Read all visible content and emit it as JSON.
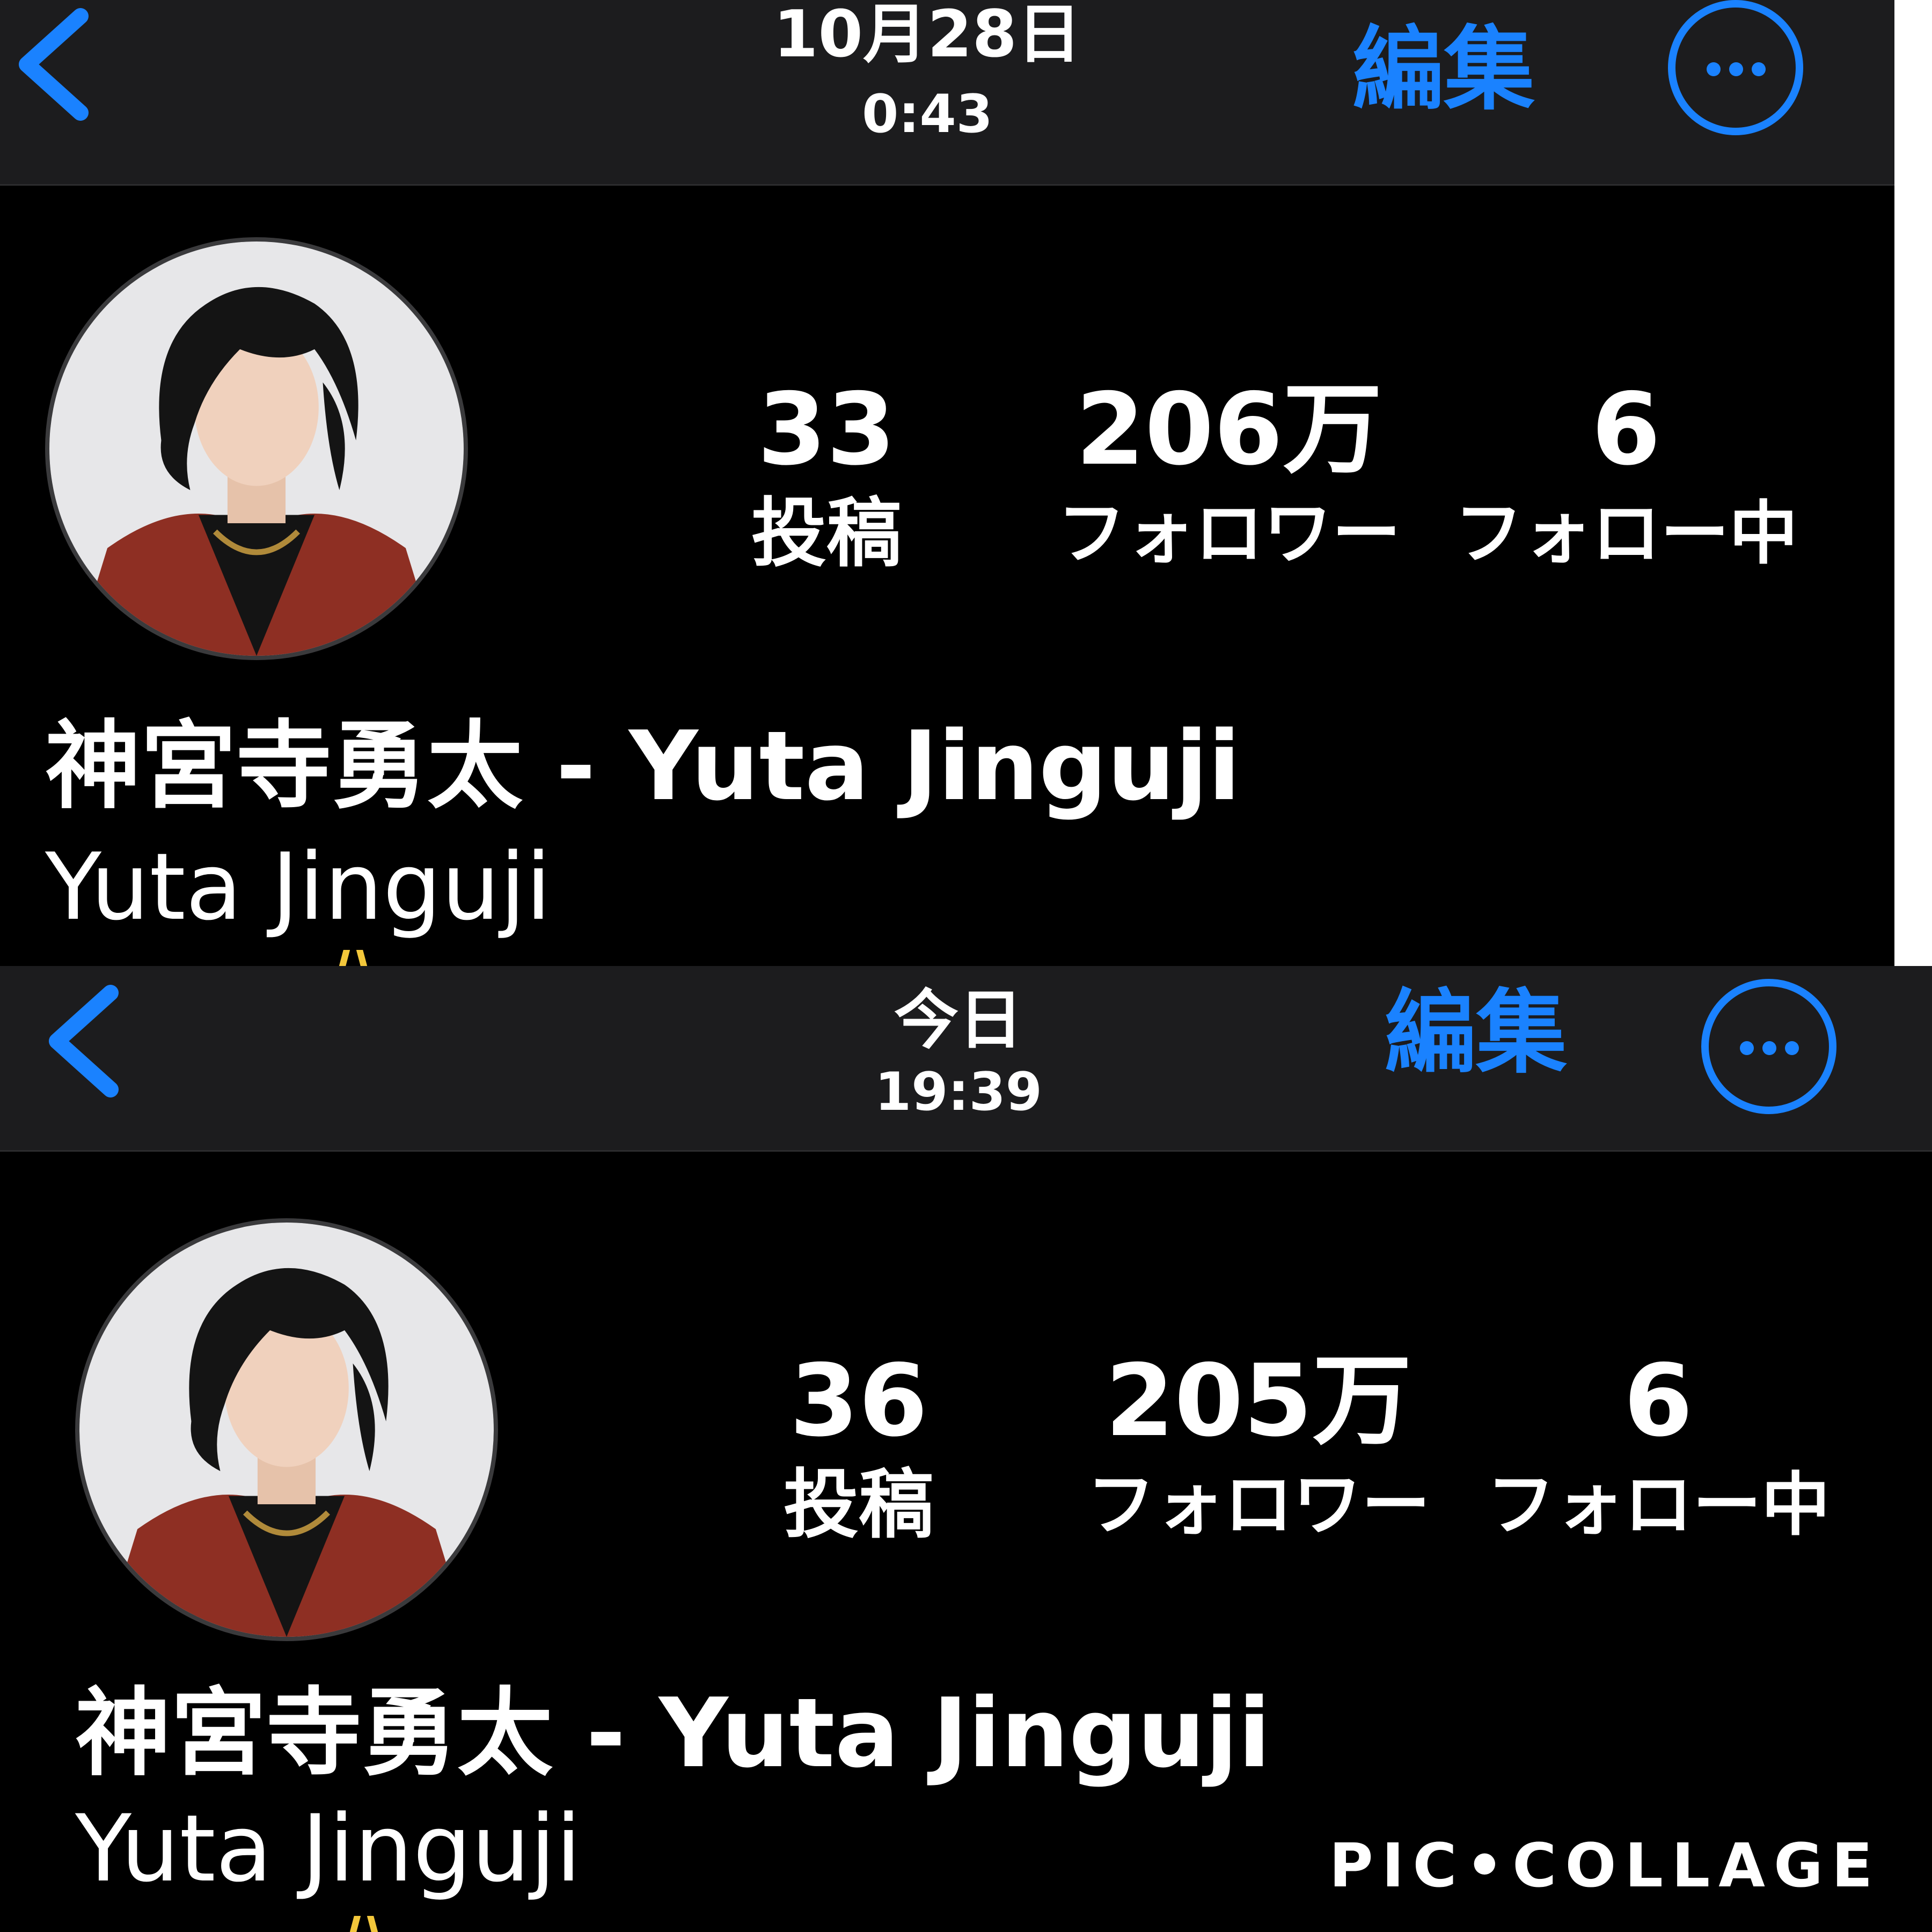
{
  "collage": {
    "watermark": "PIC•COLLAGE"
  },
  "panels": [
    {
      "date": "10月28日",
      "time": "0:43",
      "edit_label": "編集",
      "stats": {
        "posts": {
          "value": "33",
          "label": "投稿"
        },
        "followers": {
          "value": "206万",
          "label": "フォロワー"
        },
        "following": {
          "value": "6",
          "label": "フォロー中"
        }
      },
      "display_name": "神宮寺勇太 - Yuta Jinguji",
      "username": "Yuta Jinguji"
    },
    {
      "date": "今日",
      "time": "19:39",
      "edit_label": "編集",
      "stats": {
        "posts": {
          "value": "36",
          "label": "投稿"
        },
        "followers": {
          "value": "205万",
          "label": "フォロワー"
        },
        "following": {
          "value": "6",
          "label": "フォロー中"
        }
      },
      "display_name": "神宮寺勇太 - Yuta Jinguji",
      "username": "Yuta Jinguji"
    }
  ],
  "colors": {
    "accent": "#1a82ff",
    "navbar": "#1c1c1e",
    "background": "#000000",
    "text": "#ffffff"
  },
  "icons": {
    "back": "chevron-left-icon",
    "more": "ellipsis-circle-icon"
  }
}
